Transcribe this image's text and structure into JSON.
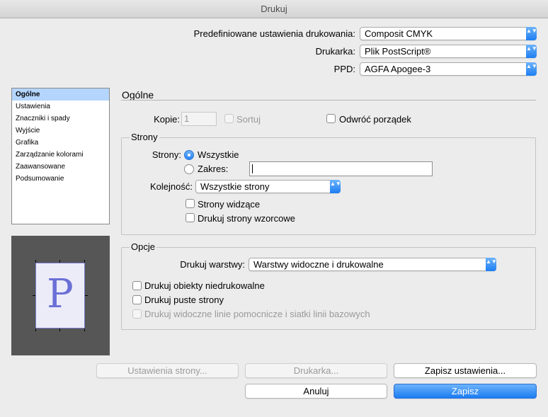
{
  "window": {
    "title": "Drukuj"
  },
  "top": {
    "preset_label": "Predefiniowane ustawienia drukowania:",
    "preset_value": "Composit CMYK",
    "printer_label": "Drukarka:",
    "printer_value": "Plik PostScript®",
    "ppd_label": "PPD:",
    "ppd_value": "AGFA Apogee-3",
    "popup_arrow": "▲▼"
  },
  "sidebar": {
    "items": [
      {
        "label": "Ogólne"
      },
      {
        "label": "Ustawienia"
      },
      {
        "label": "Znaczniki i spady"
      },
      {
        "label": "Wyjście"
      },
      {
        "label": "Grafika"
      },
      {
        "label": "Zarządzanie kolorami"
      },
      {
        "label": "Zaawansowane"
      },
      {
        "label": "Podsumowanie"
      }
    ],
    "selected_index": 0
  },
  "preview": {
    "page_letter": "P"
  },
  "section": {
    "title": "Ogólne"
  },
  "copies": {
    "label": "Kopie:",
    "value": "1",
    "collate_label": "Sortuj",
    "reverse_label": "Odwróć porządek"
  },
  "pages": {
    "group_title": "Strony",
    "label": "Strony:",
    "all_label": "Wszystkie",
    "range_label": "Zakres:",
    "range_value": "",
    "order_label": "Kolejność:",
    "order_value": "Wszystkie strony",
    "spreads_label": "Strony widzące",
    "master_label": "Drukuj strony wzorcowe"
  },
  "options": {
    "group_title": "Opcje",
    "layers_label": "Drukuj warstwy:",
    "layers_value": "Warstwy widoczne i drukowalne",
    "nonprinting_label": "Drukuj obiekty niedrukowalne",
    "blank_label": "Drukuj puste strony",
    "guides_label": "Drukuj widoczne linie pomocnicze i siatki linii bazowych"
  },
  "buttons": {
    "page_setup": "Ustawienia strony...",
    "printer": "Drukarka...",
    "save_preset": "Zapisz ustawienia...",
    "cancel": "Anuluj",
    "save": "Zapisz"
  },
  "colors": {
    "accent": "#1e7ef2",
    "selection": "#b4d5fe"
  }
}
